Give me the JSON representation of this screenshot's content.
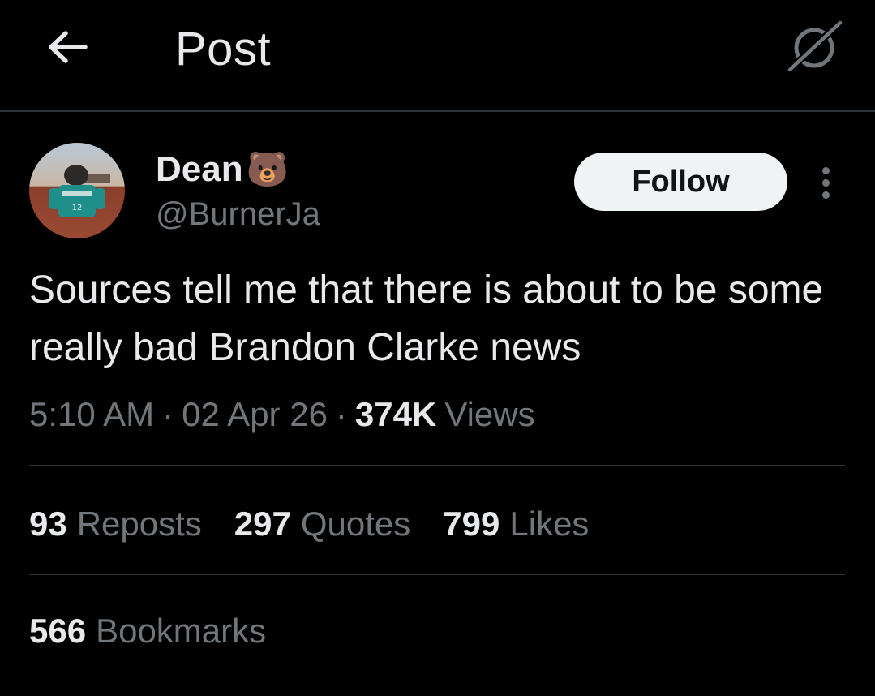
{
  "header": {
    "title": "Post",
    "back_icon": "arrow-left-icon",
    "grok_icon": "grok-icon"
  },
  "author": {
    "name": "Dean",
    "emoji": "🐻",
    "handle": "@BurnerJa"
  },
  "actions": {
    "follow_label": "Follow",
    "more_icon": "more-vertical-icon"
  },
  "post": {
    "text": "Sources tell me that there is about to be some really bad Brandon Clarke news",
    "time": "5:10 AM",
    "separator": "·",
    "date": "02 Apr 26",
    "views_count": "374K",
    "views_label": "Views"
  },
  "stats": {
    "reposts_count": "93",
    "reposts_label": "Reposts",
    "quotes_count": "297",
    "quotes_label": "Quotes",
    "likes_count": "799",
    "likes_label": "Likes",
    "bookmarks_count": "566",
    "bookmarks_label": "Bookmarks"
  },
  "colors": {
    "background": "#000000",
    "primary_text": "#e7e9ea",
    "secondary_text": "#71767b",
    "divider": "#2f3336",
    "follow_button_bg": "#eff3f4"
  }
}
